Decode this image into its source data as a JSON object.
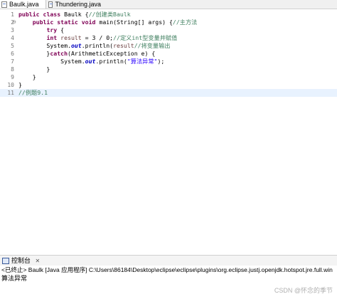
{
  "tabs": [
    {
      "label": "Baulk.java",
      "active": true
    },
    {
      "label": "Thundering.java",
      "active": false
    }
  ],
  "editor": {
    "lines": [
      {
        "num": "1",
        "fold": "",
        "tokens": [
          [
            "kw",
            "public "
          ],
          [
            "kw",
            "class "
          ],
          [
            "",
            "Baulk {"
          ],
          [
            "cm",
            "//创建类Baulk"
          ]
        ]
      },
      {
        "num": "2",
        "fold": "⊖",
        "tokens": [
          [
            "",
            "    "
          ],
          [
            "kw",
            "public "
          ],
          [
            "kw",
            "static "
          ],
          [
            "kw",
            "void "
          ],
          [
            "",
            "main(String[] args) {"
          ],
          [
            "cm",
            "//主方法"
          ]
        ]
      },
      {
        "num": "3",
        "fold": "",
        "tokens": [
          [
            "",
            "        "
          ],
          [
            "kw",
            "try"
          ],
          [
            "",
            " {"
          ]
        ]
      },
      {
        "num": "4",
        "fold": "",
        "tokens": [
          [
            "",
            "        "
          ],
          [
            "kw",
            "int "
          ],
          [
            "var",
            "result"
          ],
          [
            "",
            " = 3 / 0;"
          ],
          [
            "cm",
            "//定义int型变量并赋值"
          ]
        ]
      },
      {
        "num": "5",
        "fold": "",
        "tokens": [
          [
            "",
            "        System."
          ],
          [
            "fd",
            "out"
          ],
          [
            "",
            ".println("
          ],
          [
            "var",
            "result"
          ],
          [
            ");"
          ],
          [
            "cm",
            "//将变量输出"
          ]
        ]
      },
      {
        "num": "6",
        "fold": "",
        "tokens": [
          [
            "",
            "        }"
          ],
          [
            "kw",
            "catch"
          ],
          [
            "",
            "(ArithmeticException e) {"
          ]
        ]
      },
      {
        "num": "7",
        "fold": "",
        "tokens": [
          [
            "",
            "            System."
          ],
          [
            "fd",
            "out"
          ],
          [
            "",
            ".println("
          ],
          [
            "st",
            "\"算法异常\""
          ],
          [
            "",
            ");"
          ]
        ]
      },
      {
        "num": "8",
        "fold": "",
        "tokens": [
          [
            "",
            "        }"
          ]
        ]
      },
      {
        "num": "9",
        "fold": "",
        "tokens": [
          [
            "",
            "    }"
          ]
        ]
      },
      {
        "num": "10",
        "fold": "",
        "tokens": [
          [
            "",
            "}"
          ]
        ]
      },
      {
        "num": "11",
        "fold": "",
        "tokens": [
          [
            "cm",
            "//例题9.1"
          ]
        ]
      }
    ],
    "current_line": 10
  },
  "console": {
    "tab_label": "控制台",
    "close": "✕",
    "status": "<已终止> Baulk [Java 应用程序] C:\\Users\\86184\\Desktop\\eclipse\\eclipse\\plugins\\org.eclipse.justj.openjdk.hotspot.jre.full.win",
    "output": "算法异常"
  },
  "watermark": "CSDN @怀念的季节"
}
